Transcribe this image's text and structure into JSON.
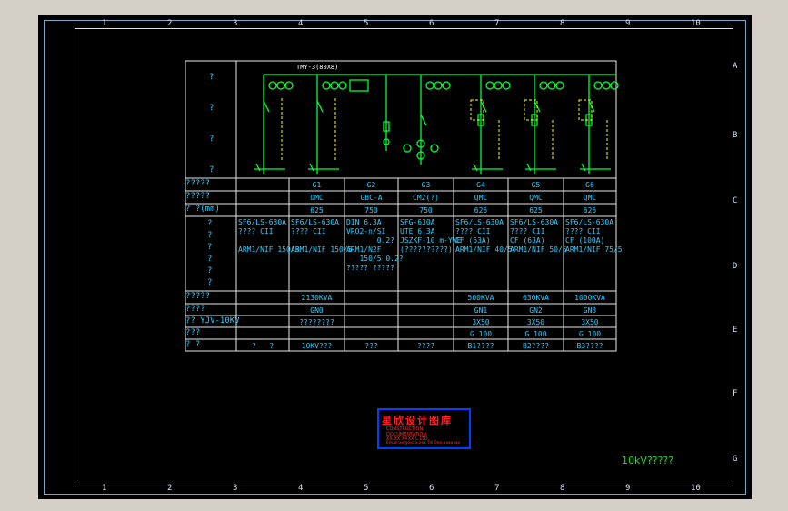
{
  "zones_top": [
    "1",
    "2",
    "3",
    "4",
    "5",
    "6",
    "7",
    "8",
    "9",
    "10"
  ],
  "zones_side": [
    "A",
    "B",
    "C",
    "D",
    "E",
    "F",
    "G"
  ],
  "busbar_label": "TMY-3(80X8)",
  "row_labels": {
    "diagram": [
      "?",
      "?",
      "?",
      "?"
    ],
    "r1": "?????",
    "r2": "?????",
    "r3": "?    ?(mm)",
    "r4": [
      "?",
      "?",
      "?",
      "?",
      "?",
      "?"
    ],
    "r5": "?????",
    "r6": "????",
    "r7": "??      YJV-10KV",
    "r8": "???",
    "r9": "?        ?"
  },
  "columns": [
    {
      "no": "",
      "type": "",
      "size": "",
      "equip": [
        "SF6/LS-630A",
        "???? CII",
        "",
        "ARM1/NIF 150/5"
      ],
      "load": "",
      "name": "",
      "cable": "",
      "ct": "",
      "note": "?   ?"
    },
    {
      "no": "G1",
      "type": "OMC",
      "size": "625",
      "equip": [
        "SF6/LS-630A",
        "???? CII",
        "",
        "ARM1/NIF 150/5"
      ],
      "load": "2130KVA",
      "name": "GN0",
      "cable": "????????",
      "ct": "",
      "note": "10KV???"
    },
    {
      "no": "G2",
      "type": "GBC-A",
      "size": "750",
      "equip": [
        "DIN 6.3A",
        "VRO2-n/SI",
        "       0.2?",
        "ARM1/N2F",
        "   150/5 0.2?",
        "????? ?????"
      ],
      "load": "",
      "name": "",
      "cable": "",
      "ct": "",
      "note": "???"
    },
    {
      "no": "G3",
      "type": "CM2(?)",
      "size": "750",
      "equip": [
        "SFG-630A",
        "UTE 6.3A",
        "JSZKF-10 m-YWE",
        "(??????????)"
      ],
      "load": "",
      "name": "",
      "cable": "",
      "ct": "",
      "note": "????"
    },
    {
      "no": "G4",
      "type": "QMC",
      "size": "625",
      "equip": [
        "SF6/LS-630A",
        "???? CII",
        "CF (63A)",
        "ARM1/NIF 40/5"
      ],
      "load": "500KVA",
      "name": "GN1",
      "cable": "3X50",
      "ct": "G 100",
      "note": "B1????"
    },
    {
      "no": "G5",
      "type": "QMC",
      "size": "625",
      "equip": [
        "SF6/LS-630A",
        "???? CII",
        "CF (63A)",
        "ARM1/NIF 50/5"
      ],
      "load": "630KVA",
      "name": "GN2",
      "cable": "3X50",
      "ct": "G 100",
      "note": "B2????"
    },
    {
      "no": "G6",
      "type": "QMC",
      "size": "625",
      "equip": [
        "SF6/LS-630A",
        "???? CII",
        "CF (100A)",
        "ARM1/NIF 75/5"
      ],
      "load": "1000KVA",
      "name": "GN3",
      "cable": "3X50",
      "ct": "G 100",
      "note": "B3????"
    }
  ],
  "stamp": {
    "title": "星欣设计图库",
    "sub1": "CONSTRUCTION",
    "sub2": "DOCUMENTATION",
    "sub3": "XX.XX.XXXX L.LTD",
    "sub4": "Email:xx@xxxx.xxx  Tel:0xx-xxxxxxx"
  },
  "footer_title": "10kV?????",
  "colors": {
    "background": "#000000",
    "frame": "#7aa7c7",
    "table_line": "#e8e8e8",
    "text": "#33ccff",
    "diagram": "#00ff33",
    "dashed": "#ffff00",
    "stamp_red": "#ff2222",
    "stamp_border": "#0040ff"
  }
}
